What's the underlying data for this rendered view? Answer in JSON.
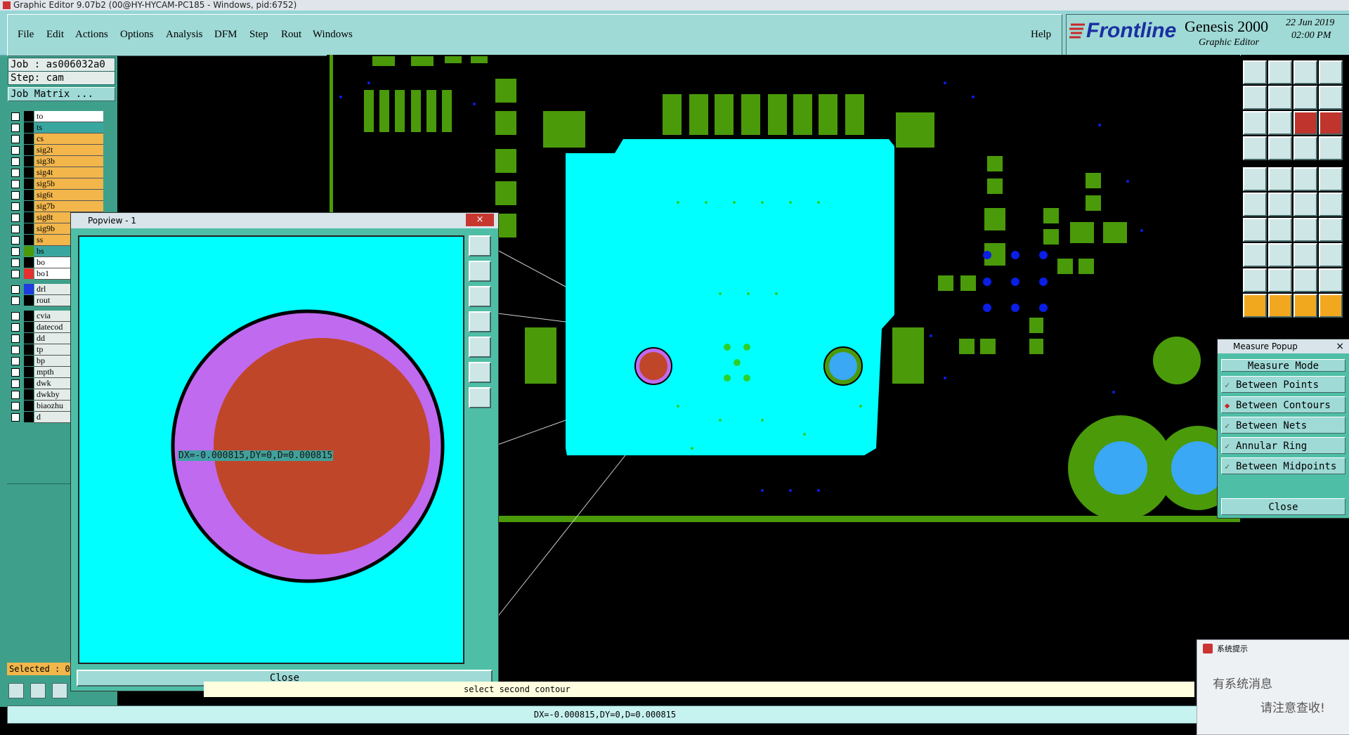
{
  "window": {
    "title": "Graphic Editor 9.07b2 (00@HY-HYCAM-PC185 - Windows, pid:6752)"
  },
  "menu": {
    "items": [
      "File",
      "Edit",
      "Actions",
      "Options",
      "Analysis",
      "DFM",
      "Step",
      "Rout",
      "Windows"
    ],
    "help": "Help"
  },
  "branding": {
    "logo": "Frontline",
    "product": "Genesis 2000",
    "subtitle": "Graphic Editor",
    "date": "22 Jun 2019",
    "time": "02:00 PM"
  },
  "left_panel": {
    "job": "Job : as006032a0",
    "step": "Step: cam",
    "job_matrix": "Job Matrix ...",
    "layers": [
      {
        "name": "to",
        "color": "#ffffff"
      },
      {
        "name": "ts",
        "color": "#3aa6a0"
      },
      {
        "name": "cs",
        "color": "#f2b64b"
      },
      {
        "name": "sig2t",
        "color": "#f2b64b"
      },
      {
        "name": "sig3b",
        "color": "#f2b64b"
      },
      {
        "name": "sig4t",
        "color": "#f2b64b"
      },
      {
        "name": "sig5b",
        "color": "#f2b64b"
      },
      {
        "name": "sig6t",
        "color": "#f2b64b"
      },
      {
        "name": "sig7b",
        "color": "#f2b64b"
      },
      {
        "name": "sig8t",
        "color": "#f2b64b"
      },
      {
        "name": "sig9b",
        "color": "#f2b64b"
      },
      {
        "name": "ss",
        "color": "#f2b64b"
      },
      {
        "name": "bs",
        "color": "#3aa6a0"
      },
      {
        "name": "bo",
        "color": "#ffffff"
      },
      {
        "name": "bo1",
        "color": "#ffffff"
      },
      {
        "name": "drl",
        "color": "#e3ece8"
      },
      {
        "name": "rout",
        "color": "#e3ece8"
      },
      {
        "name": "cvia",
        "color": "#e3ece8"
      },
      {
        "name": "datecod",
        "color": "#e3ece8"
      },
      {
        "name": "dd",
        "color": "#e3ece8"
      },
      {
        "name": "tp",
        "color": "#e3ece8"
      },
      {
        "name": "bp",
        "color": "#e3ece8"
      },
      {
        "name": "mpth",
        "color": "#e3ece8"
      },
      {
        "name": "dwk",
        "color": "#e3ece8"
      },
      {
        "name": "dwkby",
        "color": "#e3ece8"
      },
      {
        "name": "biaozhu",
        "color": "#e3ece8"
      },
      {
        "name": "d",
        "color": "#e3ece8"
      }
    ],
    "selected": "Selected : 0"
  },
  "popview": {
    "title": "Popview - 1",
    "close_x": "×",
    "measure_text": "DX=-0.000815,DY=0,D=0.000815",
    "close_label": "Close"
  },
  "measure_popup": {
    "title": "Measure Popup",
    "close_x": "×",
    "header": "Measure Mode",
    "modes": [
      "Between Points",
      "Between Contours",
      "Between Nets",
      "Annular Ring",
      "Between Midpoints"
    ],
    "selected_mode": "Between Contours",
    "close_label": "Close"
  },
  "prompt": {
    "text": "select second contour"
  },
  "status": {
    "text": "DX=-0.000815,DY=0,D=0.000815"
  },
  "notification": {
    "title": "系统提示",
    "line1": "有系统消息",
    "line2": "请注意查收!"
  },
  "colors": {
    "copper": "#4a9a0a",
    "cyan": "#00ffff",
    "via": "#0a1ee6",
    "pad": "#2bd12b",
    "drill": "#c0462a",
    "ring": "#c06af0",
    "blue_pad": "#3aa8f5"
  }
}
